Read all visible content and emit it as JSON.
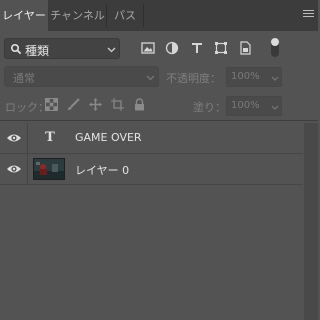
{
  "tabs": [
    {
      "label": "レイヤー",
      "active": true
    },
    {
      "label": "チャンネル",
      "active": false
    },
    {
      "label": "パス",
      "active": false
    }
  ],
  "panel_menu_icon": "hamburger-menu-icon",
  "filter": {
    "kind_label": "種類",
    "icons": [
      "pixel-layer-filter-icon",
      "adjustment-layer-filter-icon",
      "type-layer-filter-icon",
      "shape-layer-filter-icon",
      "smart-object-filter-icon"
    ],
    "toggle_icon": "filter-toggle-icon"
  },
  "blend": {
    "mode": "通常",
    "opacity_label": "不透明度：",
    "opacity_value": "100%"
  },
  "lock": {
    "label": "ロック：",
    "icons": [
      "lock-transparent-pixels-icon",
      "lock-image-pixels-icon",
      "lock-position-icon",
      "lock-artboard-icon",
      "lock-all-icon"
    ],
    "fill_label": "塗り：",
    "fill_value": "100%"
  },
  "layers": [
    {
      "name": "GAME OVER",
      "type": "text",
      "visible": true
    },
    {
      "name": "レイヤー 0",
      "type": "image",
      "visible": true
    }
  ],
  "colors": {
    "panel_bg": "#535353",
    "tabbar_bg": "#3c3c3c",
    "text": "#e4e4e4",
    "dim_text": "#7a7a7a"
  }
}
